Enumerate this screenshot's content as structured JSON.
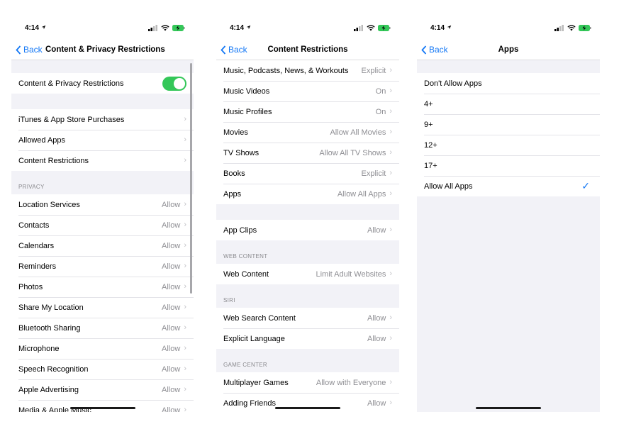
{
  "screens": [
    {
      "time": "4:14",
      "back_label": "Back",
      "title": "Content & Privacy Restrictions",
      "master_toggle": {
        "label": "Content & Privacy Restrictions",
        "on": true
      },
      "group1": [
        {
          "label": "iTunes & App Store Purchases"
        },
        {
          "label": "Allowed Apps"
        },
        {
          "label": "Content Restrictions"
        }
      ],
      "privacy_header": "PRIVACY",
      "privacy": [
        {
          "label": "Location Services",
          "value": "Allow"
        },
        {
          "label": "Contacts",
          "value": "Allow"
        },
        {
          "label": "Calendars",
          "value": "Allow"
        },
        {
          "label": "Reminders",
          "value": "Allow"
        },
        {
          "label": "Photos",
          "value": "Allow"
        },
        {
          "label": "Share My Location",
          "value": "Allow"
        },
        {
          "label": "Bluetooth Sharing",
          "value": "Allow"
        },
        {
          "label": "Microphone",
          "value": "Allow"
        },
        {
          "label": "Speech Recognition",
          "value": "Allow"
        },
        {
          "label": "Apple Advertising",
          "value": "Allow"
        },
        {
          "label": "Media & Apple Music",
          "value": "Allow"
        }
      ]
    },
    {
      "time": "4:14",
      "back_label": "Back",
      "title": "Content Restrictions",
      "group1": [
        {
          "label": "Music, Podcasts, News, & Workouts",
          "value": "Explicit"
        },
        {
          "label": "Music Videos",
          "value": "On"
        },
        {
          "label": "Music Profiles",
          "value": "On"
        },
        {
          "label": "Movies",
          "value": "Allow All Movies"
        },
        {
          "label": "TV Shows",
          "value": "Allow All TV Shows"
        },
        {
          "label": "Books",
          "value": "Explicit"
        },
        {
          "label": "Apps",
          "value": "Allow All Apps"
        }
      ],
      "group2": [
        {
          "label": "App Clips",
          "value": "Allow"
        }
      ],
      "web_header": "WEB CONTENT",
      "web": [
        {
          "label": "Web Content",
          "value": "Limit Adult Websites"
        }
      ],
      "siri_header": "SIRI",
      "siri": [
        {
          "label": "Web Search Content",
          "value": "Allow"
        },
        {
          "label": "Explicit Language",
          "value": "Allow"
        }
      ],
      "game_header": "GAME CENTER",
      "game": [
        {
          "label": "Multiplayer Games",
          "value": "Allow with Everyone"
        },
        {
          "label": "Adding Friends",
          "value": "Allow"
        }
      ]
    },
    {
      "time": "4:14",
      "back_label": "Back",
      "title": "Apps",
      "options": [
        {
          "label": "Don't Allow Apps",
          "selected": false
        },
        {
          "label": "4+",
          "selected": false
        },
        {
          "label": "9+",
          "selected": false
        },
        {
          "label": "12+",
          "selected": false
        },
        {
          "label": "17+",
          "selected": false
        },
        {
          "label": "Allow All Apps",
          "selected": true
        }
      ],
      "checkmark": "✓"
    }
  ],
  "colors": {
    "accent": "#1478f5",
    "toggle_on": "#34c759",
    "background": "#f2f2f7",
    "secondary_text": "#8e8e93"
  },
  "icons": [
    "location-arrow-icon",
    "signal-icon",
    "wifi-icon",
    "battery-charging-icon",
    "chevron-left-icon",
    "chevron-right-icon",
    "checkmark-icon"
  ]
}
